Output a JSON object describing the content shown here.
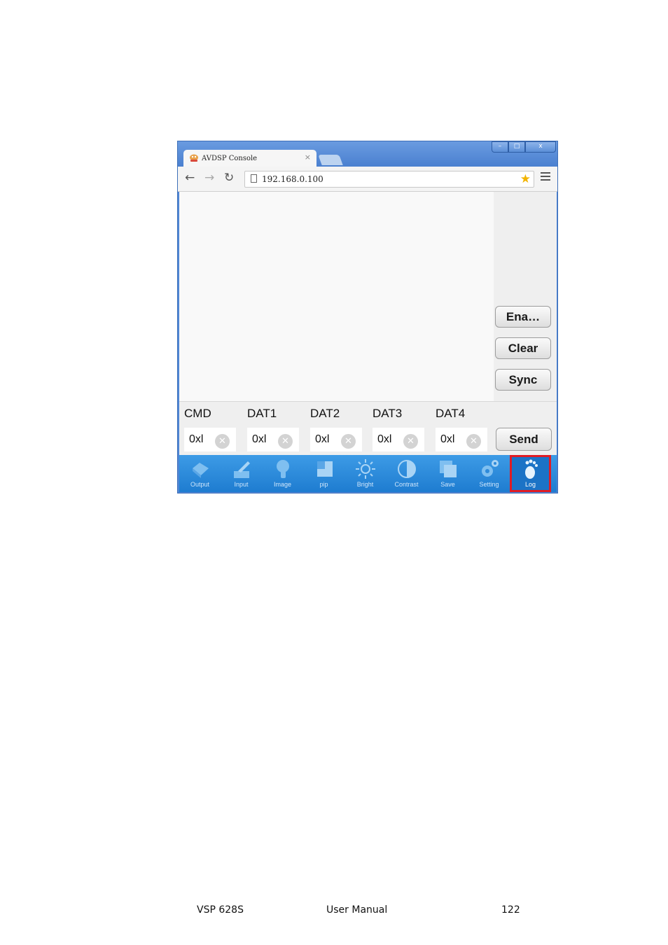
{
  "browser": {
    "tab_title": "AVDSP Console",
    "tab_close": "×",
    "url": "192.168.0.100",
    "window_controls": {
      "minimize": "–",
      "maximize": "□",
      "close": "x"
    }
  },
  "side_buttons": {
    "enable": "Ena…",
    "clear": "Clear",
    "sync": "Sync"
  },
  "fields": [
    {
      "label": "CMD",
      "value": "0xl"
    },
    {
      "label": "DAT1",
      "value": "0xl"
    },
    {
      "label": "DAT2",
      "value": "0xl"
    },
    {
      "label": "DAT3",
      "value": "0xl"
    },
    {
      "label": "DAT4",
      "value": "0xl"
    }
  ],
  "clear_glyph": "✕",
  "send_label": "Send",
  "bottom_nav": [
    {
      "label": "Output",
      "icon": "output-icon"
    },
    {
      "label": "Input",
      "icon": "input-icon"
    },
    {
      "label": "Image",
      "icon": "image-icon"
    },
    {
      "label": "pip",
      "icon": "pip-icon"
    },
    {
      "label": "Bright",
      "icon": "brightness-icon"
    },
    {
      "label": "Contrast",
      "icon": "contrast-icon"
    },
    {
      "label": "Save",
      "icon": "save-icon"
    },
    {
      "label": "Setting",
      "icon": "gear-icon"
    },
    {
      "label": "Log",
      "icon": "log-icon",
      "active": true
    }
  ],
  "colors": {
    "nav_bg": "#1e7cd0",
    "highlight": "#e01b24"
  },
  "footer": {
    "product": "VSP 628S",
    "doc": "User Manual",
    "page": "122"
  }
}
